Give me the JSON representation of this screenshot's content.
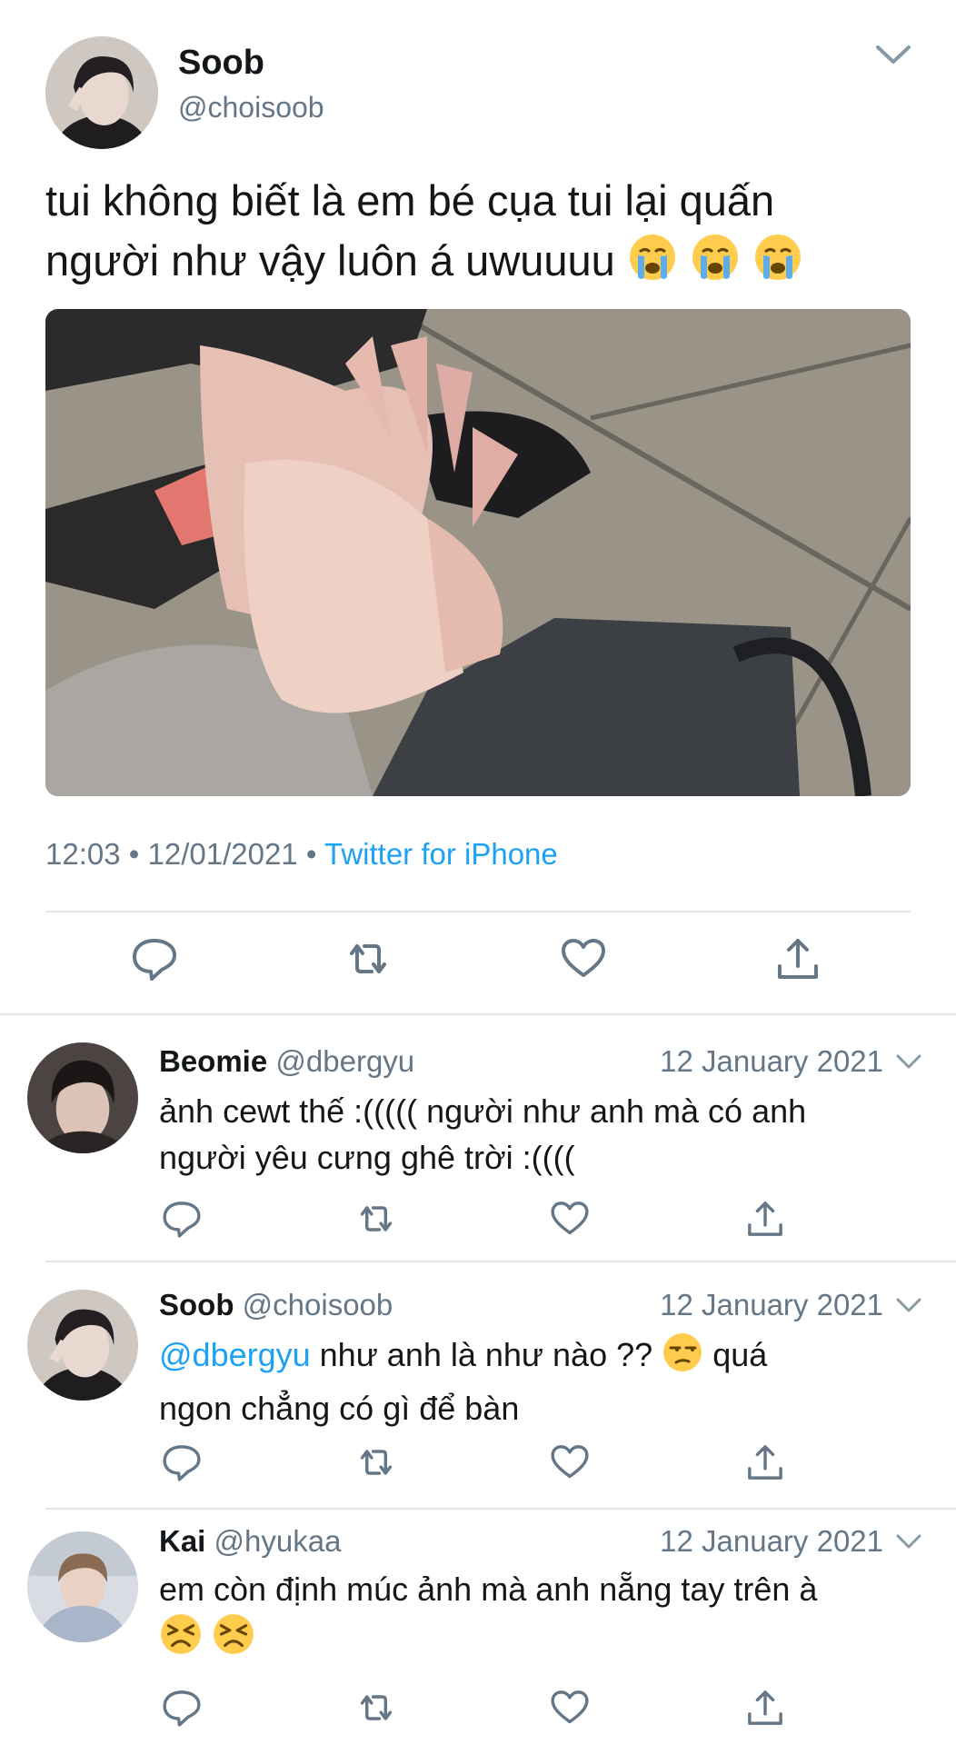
{
  "main_tweet": {
    "author_name": "Soob",
    "author_handle": "@choisoob",
    "text_line1": "tui không biết là em bé cụa tui lại quấn",
    "text_line2": "người như vậy luôn á uwuuuu",
    "emoji": [
      "loudly-crying-face",
      "loudly-crying-face",
      "loudly-crying-face"
    ],
    "time": "12:03",
    "date": "12/01/2021",
    "separator": "•",
    "source": "Twitter for iPhone",
    "actions": [
      "reply-icon",
      "retweet-icon",
      "like-icon",
      "share-icon"
    ]
  },
  "replies": [
    {
      "name": "Beomie",
      "handle": "@dbergyu",
      "date": "12 January 2021",
      "line1": "ảnh cewt thế :((((( người như anh mà có anh",
      "line2": "người yêu cưng ghê trời :(((("
    },
    {
      "name": "Soob",
      "handle": "@choisoob",
      "date": "12 January 2021",
      "mention": "@dbergyu",
      "line1": "như anh là như nào ??",
      "line1_after": "quá",
      "line2": "ngon chẳng có gì để bàn",
      "emoji": [
        "unamused-face"
      ]
    },
    {
      "name": "Kai",
      "handle": "@hyukaa",
      "date": "12 January 2021",
      "line1": "em còn định múc ảnh mà anh nẵng tay trên à",
      "emoji": [
        "persevering-face",
        "persevering-face"
      ]
    }
  ],
  "colors": {
    "link": "#1da1f2",
    "secondary_text": "#657786",
    "icon": "#657786",
    "divider": "#e1e8ed"
  }
}
